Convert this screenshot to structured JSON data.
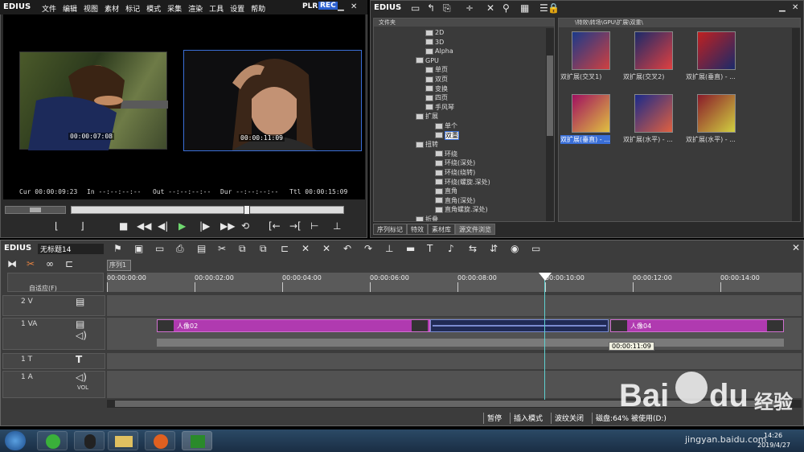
{
  "player": {
    "logo": "EDIUS",
    "menu": [
      "文件",
      "编辑",
      "视图",
      "素材",
      "标记",
      "模式",
      "采集",
      "渲染",
      "工具",
      "设置",
      "帮助"
    ],
    "plr": "PLR",
    "rec": "REC",
    "left_tc": "00:00:07:08",
    "right_tc": "00:00:11:09",
    "cur_label": "Cur",
    "cur_value": "00:00:09:23",
    "in_label": "In",
    "in_value": "--:--:--:--",
    "out_label": "Out",
    "out_value": "--:--:--:--",
    "dur_label": "Dur",
    "dur_value": "--:--:--:--",
    "ttl_label": "Ttl",
    "ttl_value": "00:00:15:09",
    "playhead_fraction": 0.64
  },
  "bin": {
    "logo": "EDIUS",
    "tree_header": "文件夹",
    "path": "\\特效\\转场\\GPU\\扩展\\双重\\",
    "tree": [
      {
        "label": "2D",
        "level": 2
      },
      {
        "label": "3D",
        "level": 2
      },
      {
        "label": "Alpha",
        "level": 2
      },
      {
        "label": "GPU",
        "level": 1
      },
      {
        "label": "单页",
        "level": 2
      },
      {
        "label": "双页",
        "level": 2
      },
      {
        "label": "变换",
        "level": 2
      },
      {
        "label": "四页",
        "level": 2
      },
      {
        "label": "手风琴",
        "level": 2
      },
      {
        "label": "扩展",
        "level": 1
      },
      {
        "label": "单个",
        "level": 3
      },
      {
        "label": "双重",
        "level": 3,
        "selected": true
      },
      {
        "label": "扭转",
        "level": 1
      },
      {
        "label": "环绕",
        "level": 3
      },
      {
        "label": "环绕(深处)",
        "level": 3
      },
      {
        "label": "环绕(绕转)",
        "level": 3
      },
      {
        "label": "环绕(螺旋.深处)",
        "level": 3
      },
      {
        "label": "直角",
        "level": 3
      },
      {
        "label": "直角(深处)",
        "level": 3
      },
      {
        "label": "直角螺旋.深处)",
        "level": 3
      },
      {
        "label": "折叠",
        "level": 1
      }
    ],
    "clips": [
      "双扩展(交叉1)",
      "双扩展(交叉2)",
      "双扩展(垂直) - ...",
      "双扩展(垂直) - ...",
      "双扩展(水平) - ...",
      "双扩展(水平) - ..."
    ],
    "tabs": [
      "序列标记",
      "特效",
      "素材库",
      "源文件浏览"
    ]
  },
  "timeline": {
    "logo": "EDIUS",
    "project": "无标题14",
    "sequence_tab": "序列1",
    "fit_mode": "自适应(F)",
    "ruler": [
      "00:00:00:00",
      "00:00:02:00",
      "00:00:04:00",
      "00:00:06:00",
      "00:00:08:00",
      "00:00:10:00",
      "00:00:12:00",
      "00:00:14:00"
    ],
    "tracks": [
      {
        "name": "2 V",
        "kind": "video"
      },
      {
        "name": "1 VA",
        "kind": "videoaudio"
      },
      {
        "name": "1 T",
        "kind": "title"
      },
      {
        "name": "1 A",
        "kind": "audio",
        "vol": "VOL"
      }
    ],
    "clip_a": "人像02",
    "clip_b": "人像04",
    "tooltip": "00:00:11:09",
    "status": [
      "暂停",
      "插入模式",
      "波纹关闭",
      "磁盘:64% 被使用(D:)"
    ]
  },
  "taskbar": {
    "time": "14:26",
    "date": "2019/4/27"
  },
  "watermark": {
    "brand": "Bai",
    "brand2": "du",
    "cn": "经验",
    "url": "jingyan.baidu.com"
  },
  "colors": {
    "accent": "#3a6fd8",
    "clip": "#b03ab0",
    "playhead": "#5fd0d0",
    "rec": "#2a5fd0"
  }
}
